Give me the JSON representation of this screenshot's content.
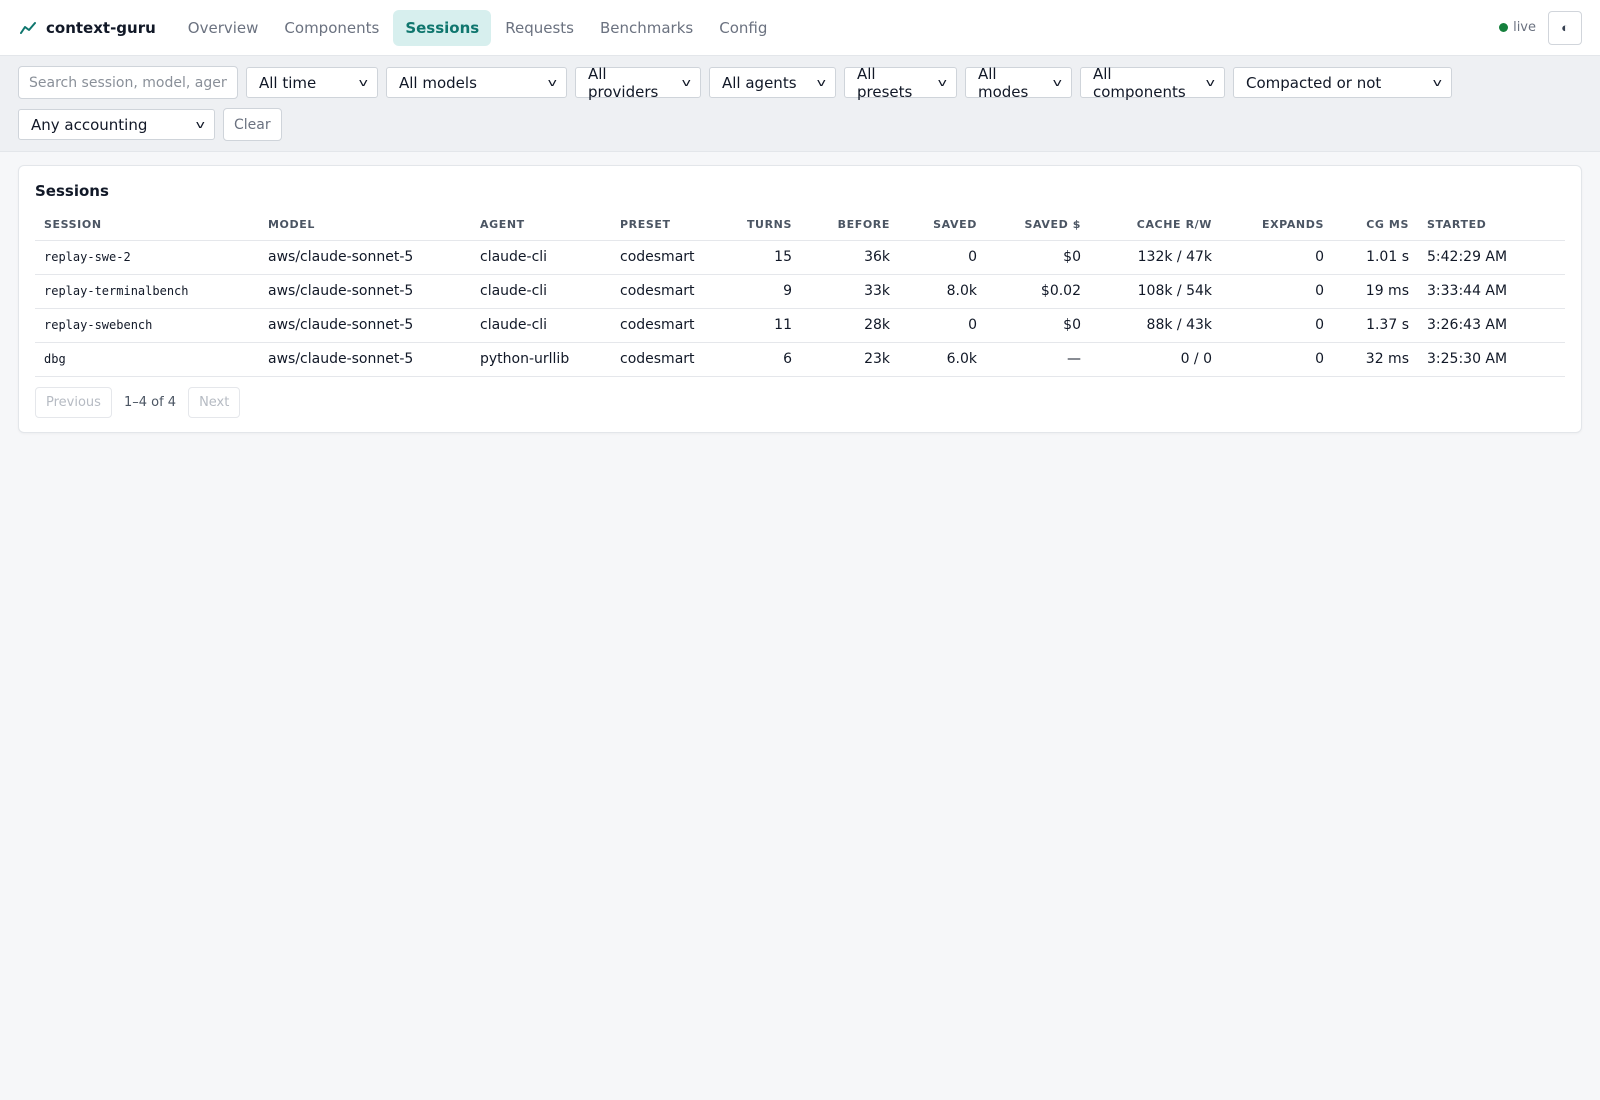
{
  "brand": {
    "name": "context-guru",
    "icon": "trend-line-icon",
    "accent": "#0f766e"
  },
  "nav": [
    {
      "label": "Overview",
      "active": false
    },
    {
      "label": "Components",
      "active": false
    },
    {
      "label": "Sessions",
      "active": true
    },
    {
      "label": "Requests",
      "active": false
    },
    {
      "label": "Benchmarks",
      "active": false
    },
    {
      "label": "Config",
      "active": false
    }
  ],
  "status": {
    "label": "live",
    "color": "#15803d"
  },
  "theme_toggle": {
    "glyph": "◐",
    "icon": "contrast-icon"
  },
  "filters": {
    "search_placeholder": "Search session, model, agent",
    "selects": [
      {
        "name": "time",
        "value": "All time"
      },
      {
        "name": "models",
        "value": "All models"
      },
      {
        "name": "providers",
        "value": "All providers"
      },
      {
        "name": "agents",
        "value": "All agents"
      },
      {
        "name": "presets",
        "value": "All presets"
      },
      {
        "name": "modes",
        "value": "All modes"
      },
      {
        "name": "components",
        "value": "All components"
      },
      {
        "name": "compacted",
        "value": "Compacted or not"
      },
      {
        "name": "accounting",
        "value": "Any accounting"
      }
    ],
    "clear_label": "Clear"
  },
  "sessions": {
    "title": "Sessions",
    "columns": [
      "SESSION",
      "MODEL",
      "AGENT",
      "PRESET",
      "TURNS",
      "BEFORE",
      "SAVED",
      "SAVED $",
      "CACHE R/W",
      "EXPANDS",
      "CG MS",
      "STARTED"
    ],
    "rows": [
      {
        "session": "replay-swe-2",
        "model": "aws/claude-sonnet-5",
        "agent": "claude-cli",
        "preset": "codesmart",
        "turns": "15",
        "before": "36k",
        "saved": "0",
        "saved_usd": "$0",
        "cache": "132k / 47k",
        "expands": "0",
        "cg_ms": "1.01 s",
        "started": "5:42:29 AM"
      },
      {
        "session": "replay-terminalbench",
        "model": "aws/claude-sonnet-5",
        "agent": "claude-cli",
        "preset": "codesmart",
        "turns": "9",
        "before": "33k",
        "saved": "8.0k",
        "saved_usd": "$0.02",
        "cache": "108k / 54k",
        "expands": "0",
        "cg_ms": "19 ms",
        "started": "3:33:44 AM"
      },
      {
        "session": "replay-swebench",
        "model": "aws/claude-sonnet-5",
        "agent": "claude-cli",
        "preset": "codesmart",
        "turns": "11",
        "before": "28k",
        "saved": "0",
        "saved_usd": "$0",
        "cache": "88k / 43k",
        "expands": "0",
        "cg_ms": "1.37 s",
        "started": "3:26:43 AM"
      },
      {
        "session": "dbg",
        "model": "aws/claude-sonnet-5",
        "agent": "python-urllib",
        "preset": "codesmart",
        "turns": "6",
        "before": "23k",
        "saved": "6.0k",
        "saved_usd": "—",
        "cache": "0 / 0",
        "expands": "0",
        "cg_ms": "32 ms",
        "started": "3:25:30 AM"
      }
    ],
    "pagination": {
      "previous_label": "Previous",
      "info": "1–4 of 4",
      "next_label": "Next"
    }
  }
}
